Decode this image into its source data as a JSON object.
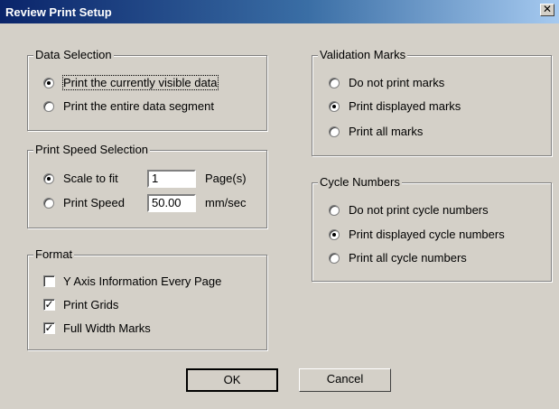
{
  "window": {
    "title": "Review Print Setup",
    "close_glyph": "✕"
  },
  "data_selection": {
    "legend": "Data Selection",
    "options": [
      "Print the currently visible data",
      "Print the entire data segment"
    ],
    "selected": 0
  },
  "print_speed": {
    "legend": "Print Speed Selection",
    "scale_label": "Scale to fit",
    "pages_value": "1",
    "pages_unit": "Page(s)",
    "speed_label": "Print Speed",
    "speed_value": "50.00",
    "speed_unit": "mm/sec",
    "selected": "scale_to_fit"
  },
  "format": {
    "legend": "Format",
    "items": [
      {
        "label": "Y Axis Information Every Page",
        "checked": false
      },
      {
        "label": "Print Grids",
        "checked": true
      },
      {
        "label": "Full Width Marks",
        "checked": true
      }
    ]
  },
  "validation_marks": {
    "legend": "Validation Marks",
    "options": [
      "Do not print marks",
      "Print displayed marks",
      "Print all marks"
    ],
    "selected": 1
  },
  "cycle_numbers": {
    "legend": "Cycle Numbers",
    "options": [
      "Do not print cycle numbers",
      "Print displayed cycle numbers",
      "Print all cycle numbers"
    ],
    "selected": 1
  },
  "buttons": {
    "ok": "OK",
    "cancel": "Cancel"
  }
}
